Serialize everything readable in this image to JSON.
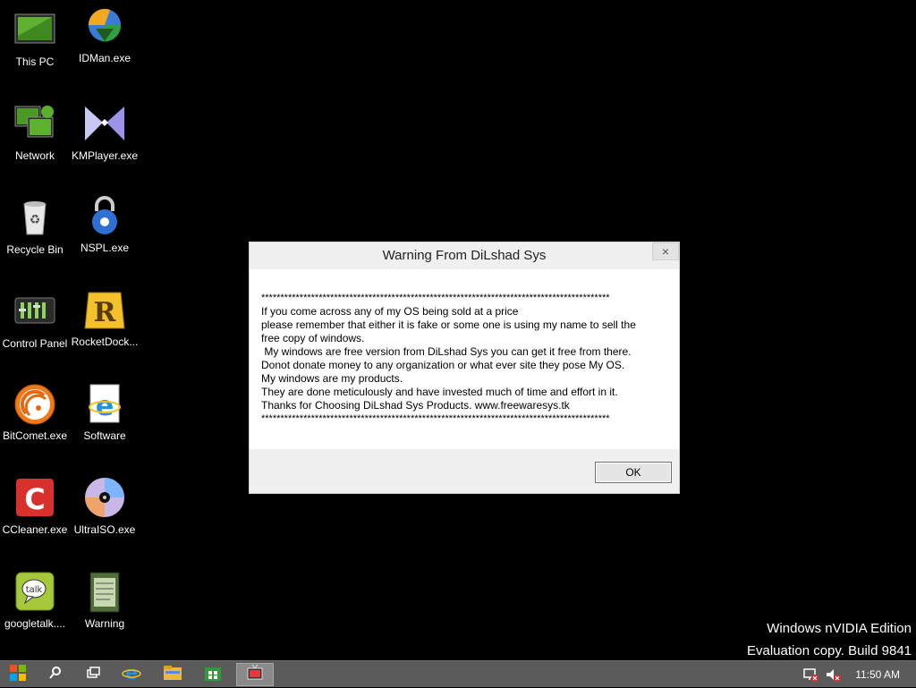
{
  "desktop": {
    "icons": [
      {
        "label": "This PC",
        "icon": "monitor-icon"
      },
      {
        "label": "IDMan.exe",
        "icon": "idm-globe-icon"
      },
      {
        "label": "Network",
        "icon": "network-icon"
      },
      {
        "label": "KMPlayer.exe",
        "icon": "kmplayer-icon"
      },
      {
        "label": "Recycle Bin",
        "icon": "recycle-bin-icon"
      },
      {
        "label": "NSPL.exe",
        "icon": "lock-icon"
      },
      {
        "label": "Control Panel",
        "icon": "control-panel-icon"
      },
      {
        "label": "RocketDock...",
        "icon": "rocketdock-icon"
      },
      {
        "label": "BitComet.exe",
        "icon": "bitcomet-icon"
      },
      {
        "label": "Software",
        "icon": "ie-document-icon"
      },
      {
        "label": "CCleaner.exe",
        "icon": "ccleaner-icon"
      },
      {
        "label": "UltraISO.exe",
        "icon": "disc-icon"
      },
      {
        "label": "googletalk....",
        "icon": "talk-icon"
      },
      {
        "label": "Warning",
        "icon": "notepad-icon"
      }
    ],
    "watermark": {
      "line1": "Windows nVIDIA Edition",
      "line2": "Evaluation copy. Build 9841"
    }
  },
  "dialog": {
    "title": "Warning From DiLshad Sys",
    "close_label": "×",
    "lines": [
      "*******************************************************************************************",
      "If you come across any of my OS being sold at a price",
      "please remember that either it is fake or some one is using my name to sell the",
      "free copy of windows.",
      " My windows are free version from DiLshad Sys you can get it free from there.",
      "Donot donate money to any organization or what ever site they pose My OS.",
      "My windows are my products.",
      "They are done meticulously and have invested much of time and effort in it.",
      "Thanks for Choosing DiLshad Sys Products. www.freewaresys.tk",
      "*******************************************************************************************"
    ],
    "ok_label": "OK"
  },
  "taskbar": {
    "items": [
      "start-icon",
      "search-icon",
      "task-view-icon",
      "internet-explorer-icon",
      "file-explorer-icon",
      "store-icon",
      "tv-app-icon"
    ],
    "tray": [
      "network-warning-icon",
      "volume-muted-icon"
    ],
    "clock": "11:50 AM"
  }
}
